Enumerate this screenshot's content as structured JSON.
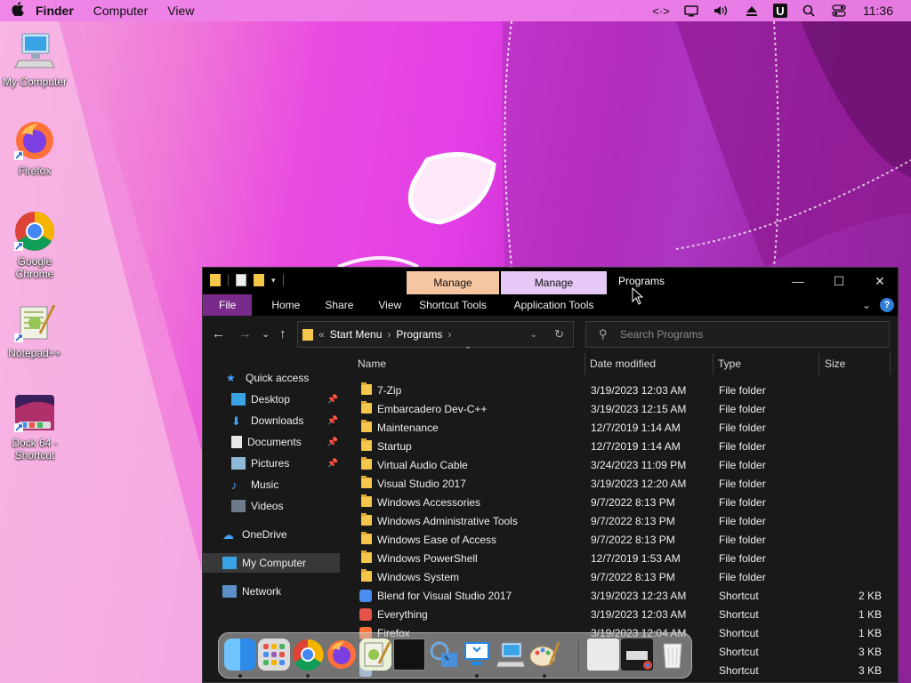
{
  "menubar": {
    "apple": "",
    "items": [
      "Finder",
      "Computer",
      "View"
    ],
    "clock": "11:36"
  },
  "desktop": {
    "icons": [
      {
        "label": "My Computer"
      },
      {
        "label": "Firefox"
      },
      {
        "label": "Google Chrome"
      },
      {
        "label": "Notepad++"
      },
      {
        "label": "Dock 64 - Shortcut"
      }
    ]
  },
  "window": {
    "title": "Programs",
    "context_tabs": [
      "Manage",
      "Manage"
    ],
    "ribbon_tabs": [
      "File",
      "Home",
      "Share",
      "View"
    ],
    "context_subtabs": [
      "Shortcut Tools",
      "Application Tools"
    ],
    "address": {
      "prefix": "«",
      "crumbs": [
        "Start Menu",
        "Programs"
      ]
    },
    "search_placeholder": "Search Programs",
    "nav": {
      "quick_access": "Quick access",
      "items": [
        "Desktop",
        "Downloads",
        "Documents",
        "Pictures",
        "Music",
        "Videos"
      ],
      "onedrive": "OneDrive",
      "my_computer": "My Computer",
      "network": "Network"
    },
    "columns": [
      "Name",
      "Date modified",
      "Type",
      "Size"
    ],
    "files": [
      {
        "name": "7-Zip",
        "date": "3/19/2023 12:03 AM",
        "type": "File folder",
        "size": ""
      },
      {
        "name": "Embarcadero Dev-C++",
        "date": "3/19/2023 12:15 AM",
        "type": "File folder",
        "size": ""
      },
      {
        "name": "Maintenance",
        "date": "12/7/2019 1:14 AM",
        "type": "File folder",
        "size": ""
      },
      {
        "name": "Startup",
        "date": "12/7/2019 1:14 AM",
        "type": "File folder",
        "size": ""
      },
      {
        "name": "Virtual Audio Cable",
        "date": "3/24/2023 11:09 PM",
        "type": "File folder",
        "size": ""
      },
      {
        "name": "Visual Studio 2017",
        "date": "3/19/2023 12:20 AM",
        "type": "File folder",
        "size": ""
      },
      {
        "name": "Windows Accessories",
        "date": "9/7/2022 8:13 PM",
        "type": "File folder",
        "size": ""
      },
      {
        "name": "Windows Administrative Tools",
        "date": "9/7/2022 8:13 PM",
        "type": "File folder",
        "size": ""
      },
      {
        "name": "Windows Ease of Access",
        "date": "9/7/2022 8:13 PM",
        "type": "File folder",
        "size": ""
      },
      {
        "name": "Windows PowerShell",
        "date": "12/7/2019 1:53 AM",
        "type": "File folder",
        "size": ""
      },
      {
        "name": "Windows System",
        "date": "9/7/2022 8:13 PM",
        "type": "File folder",
        "size": ""
      },
      {
        "name": "Blend for Visual Studio 2017",
        "date": "3/19/2023 12:23 AM",
        "type": "Shortcut",
        "size": "2 KB"
      },
      {
        "name": "Everything",
        "date": "3/19/2023 12:03 AM",
        "type": "Shortcut",
        "size": "1 KB"
      },
      {
        "name": "Firefox",
        "date": "3/19/2023 12:04 AM",
        "type": "Shortcut",
        "size": "1 KB"
      },
      {
        "name": "",
        "date": "",
        "type": "Shortcut",
        "size": "3 KB"
      },
      {
        "name": "",
        "date": "",
        "type": "Shortcut",
        "size": "3 KB"
      }
    ]
  },
  "dock": {
    "apps": [
      "finder-icon",
      "launchpad-icon",
      "chrome-icon",
      "firefox-icon",
      "notepadpp-icon",
      "terminal-icon",
      "preview-icon",
      "remote-desktop-icon",
      "my-computer-icon",
      "paint-icon",
      "window-thumb-1",
      "window-thumb-2",
      "trash-icon"
    ]
  },
  "colors": {
    "file_tab": "#7a2a8a",
    "manage1": "#f6c6a3",
    "manage2": "#e5c8f5",
    "folder": "#f4c64a"
  }
}
